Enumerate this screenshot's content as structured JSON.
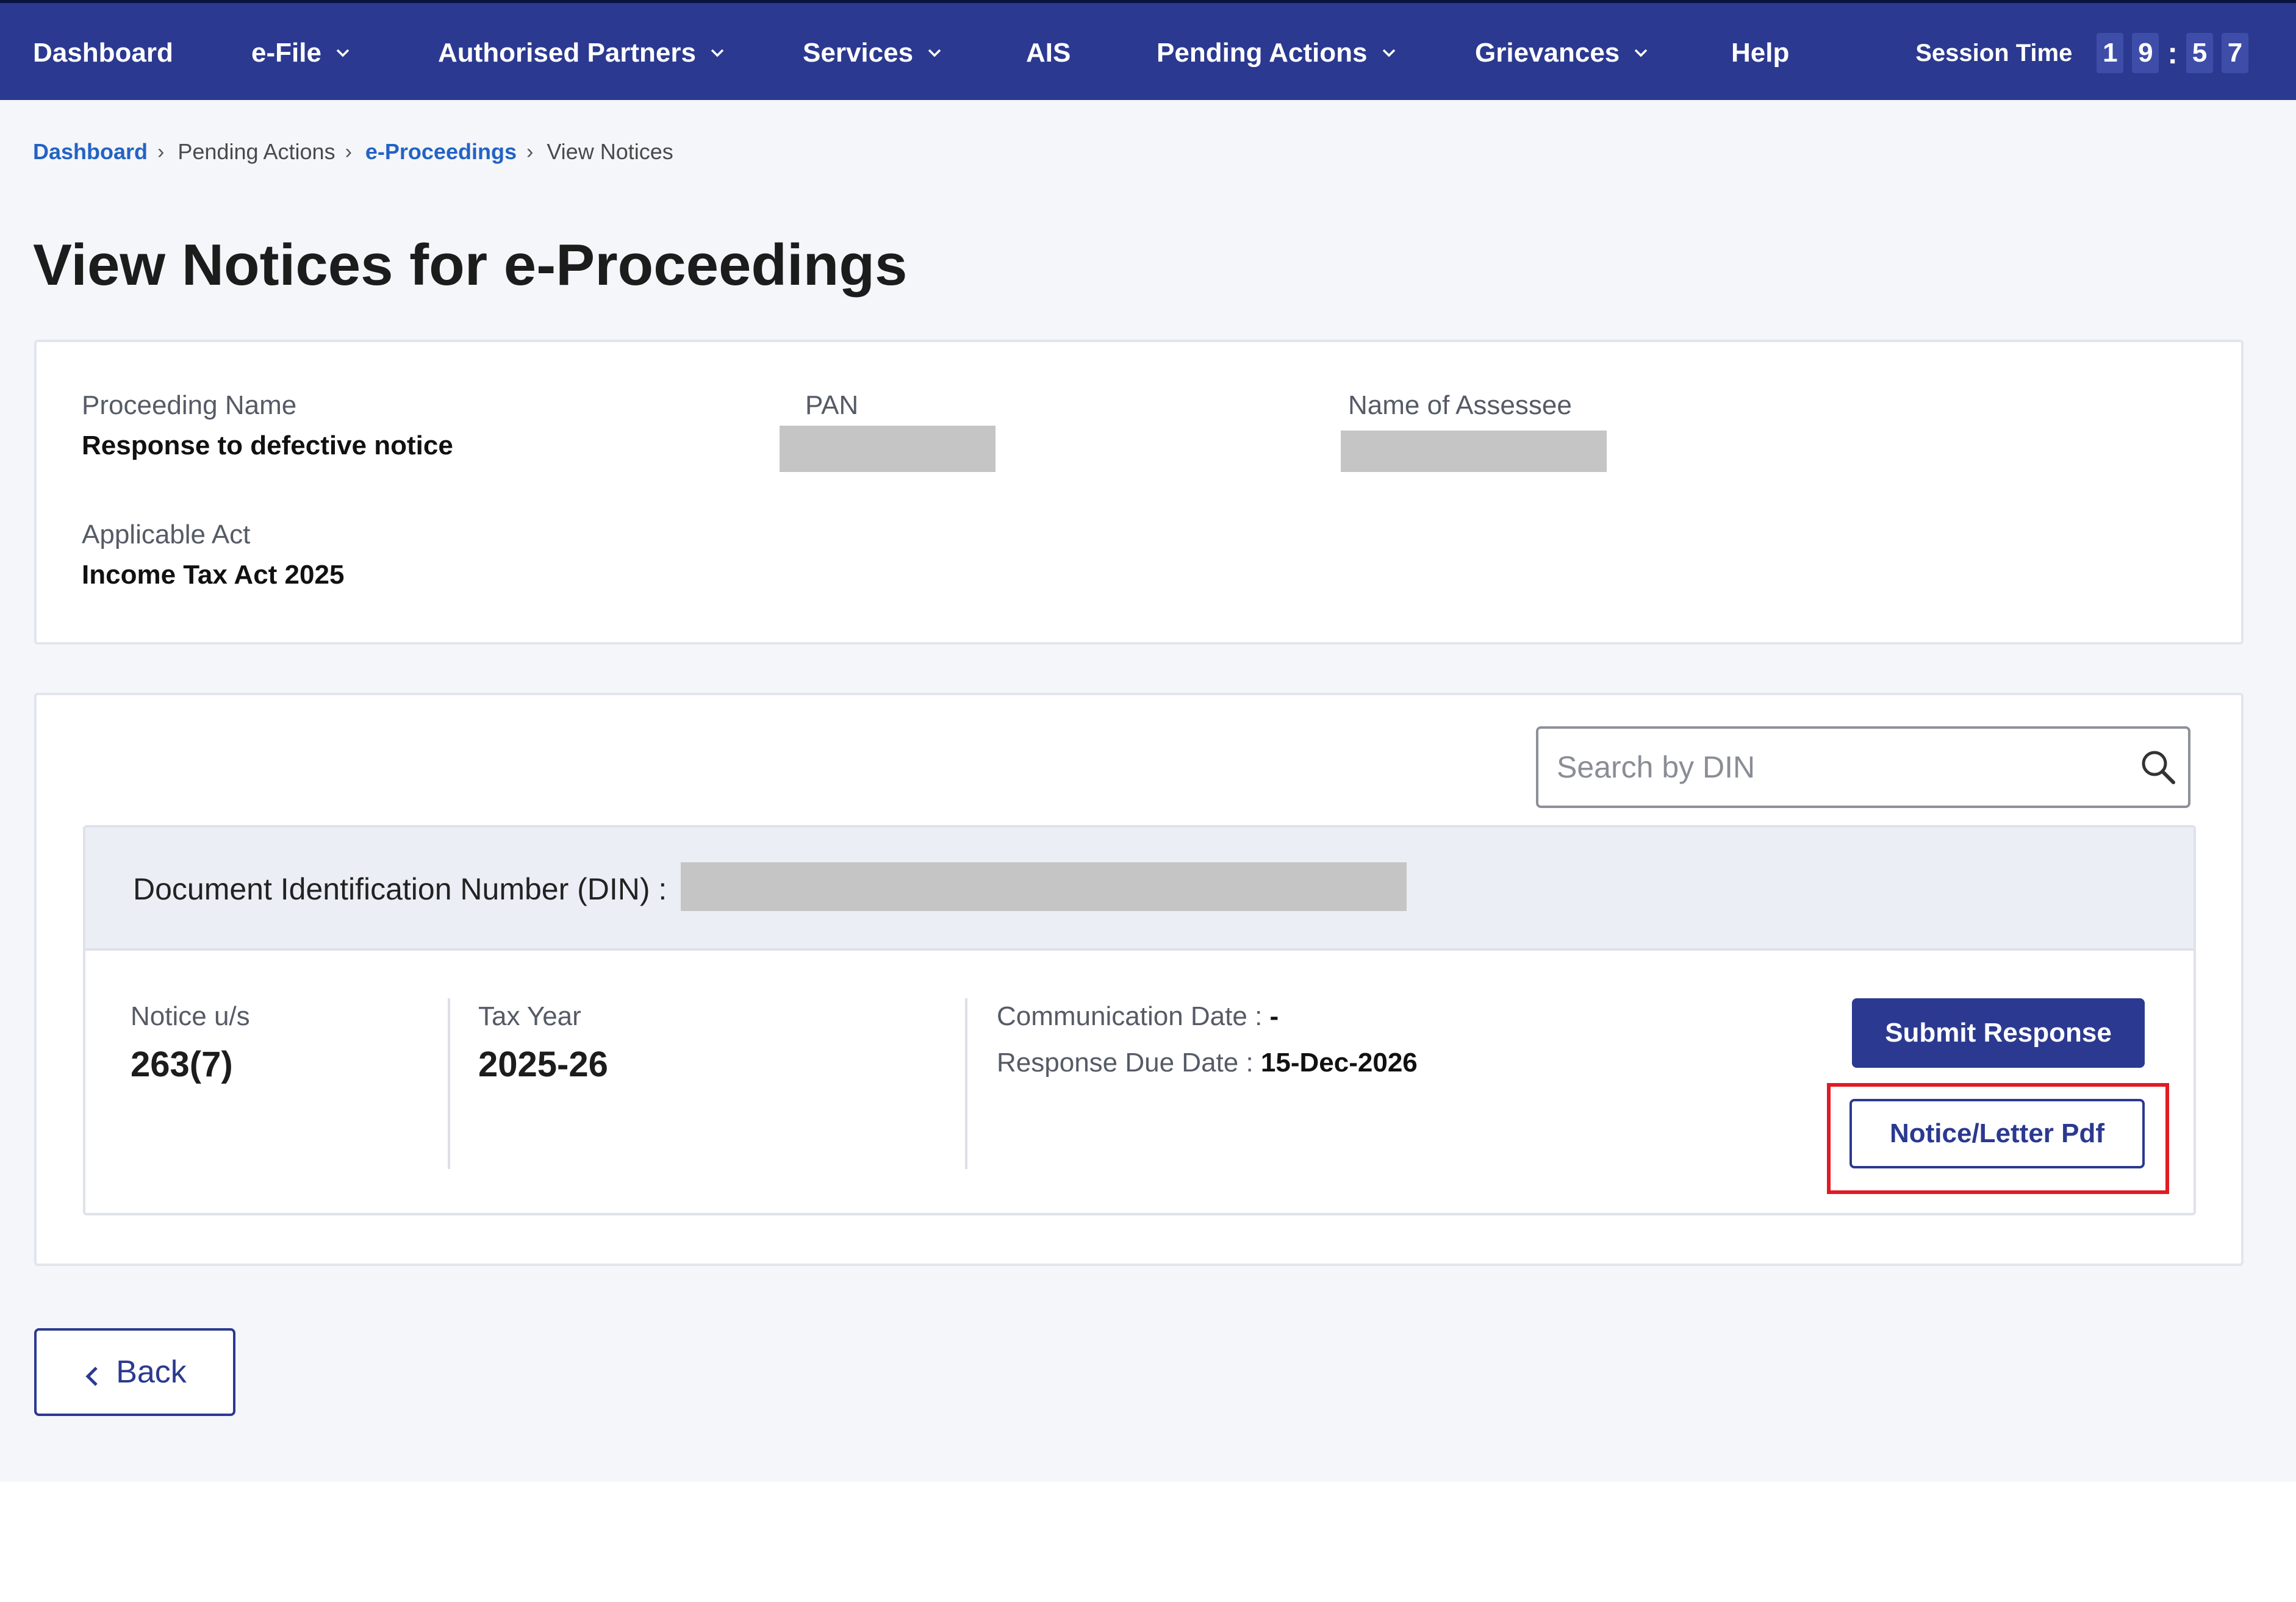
{
  "nav": {
    "items": [
      {
        "label": "Dashboard",
        "dropdown": false
      },
      {
        "label": "e-File",
        "dropdown": true
      },
      {
        "label": "Authorised Partners",
        "dropdown": true
      },
      {
        "label": "Services",
        "dropdown": true
      },
      {
        "label": "AIS",
        "dropdown": false
      },
      {
        "label": "Pending Actions",
        "dropdown": true
      },
      {
        "label": "Grievances",
        "dropdown": true
      },
      {
        "label": "Help",
        "dropdown": false
      }
    ],
    "session_label": "Session Time",
    "session_digits": [
      "1",
      "9",
      "5",
      "7"
    ],
    "session_separator": ":"
  },
  "breadcrumb": [
    {
      "label": "Dashboard",
      "link": true
    },
    {
      "label": "Pending Actions",
      "link": false
    },
    {
      "label": "e-Proceedings",
      "link": true
    },
    {
      "label": "View Notices",
      "link": false
    }
  ],
  "page_title": "View Notices for e-Proceedings",
  "proceeding": {
    "name_label": "Proceeding Name",
    "name_value": "Response to defective notice",
    "pan_label": "PAN",
    "assessee_label": "Name of Assessee",
    "act_label": "Applicable Act",
    "act_value": "Income Tax Act 2025"
  },
  "search": {
    "placeholder": "Search by DIN"
  },
  "notice": {
    "din_label": "Document Identification Number (DIN) :",
    "section_label": "Notice u/s",
    "section_value": "263(7)",
    "tax_year_label": "Tax Year",
    "tax_year_value": "2025-26",
    "comm_date_label": "Communication Date :",
    "comm_date_value": "-",
    "due_date_label": "Response Due Date :",
    "due_date_value": "15-Dec-2026",
    "submit_label": "Submit Response",
    "pdf_label": "Notice/Letter Pdf"
  },
  "back_label": "Back",
  "colors": {
    "nav_bg": "#2b3990",
    "link": "#2363c3",
    "highlight": "#e01b24"
  }
}
